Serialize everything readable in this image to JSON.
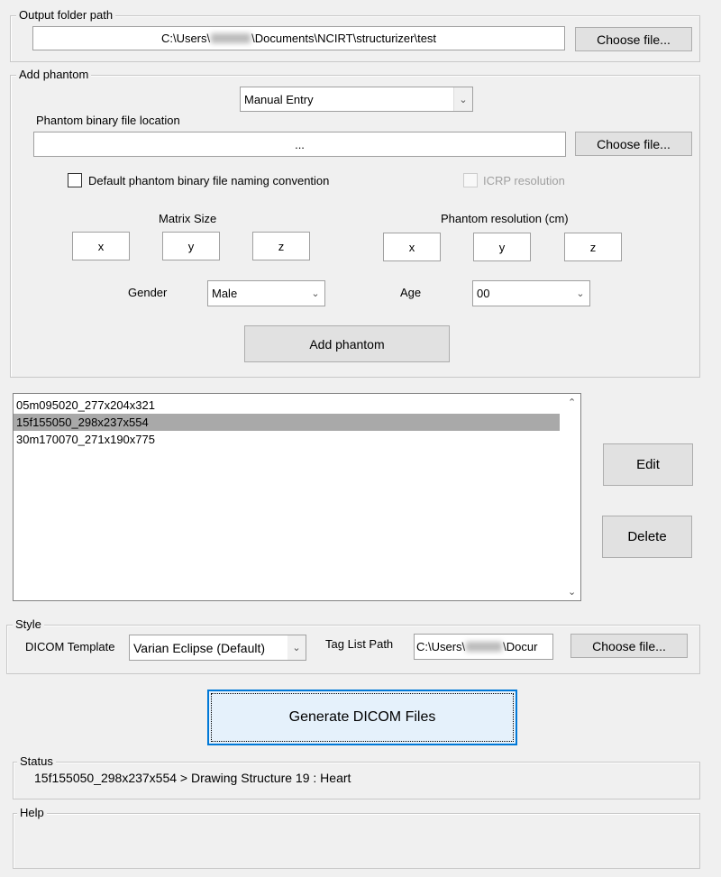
{
  "output_folder": {
    "label": "Output folder path",
    "path_prefix": "C:\\Users\\",
    "path_suffix": "\\Documents\\NCIRT\\structurizer\\test",
    "choose_label": "Choose file..."
  },
  "add_phantom": {
    "label": "Add phantom",
    "mode_select": "Manual Entry",
    "binary_location_label": "Phantom binary file location",
    "binary_location_value": "...",
    "choose_label": "Choose file...",
    "default_naming_label": "Default phantom binary file naming convention",
    "default_naming_checked": false,
    "icrp_label": "ICRP resolution",
    "icrp_checked": false,
    "matrix_size_label": "Matrix Size",
    "matrix": {
      "x": "x",
      "y": "y",
      "z": "z"
    },
    "resolution_label": "Phantom resolution (cm)",
    "resolution": {
      "x": "x",
      "y": "y",
      "z": "z"
    },
    "gender_label": "Gender",
    "gender_value": "Male",
    "age_label": "Age",
    "age_value": "00",
    "add_button": "Add phantom"
  },
  "phantom_list": {
    "items": [
      "05m095020_277x204x321",
      "15f155050_298x237x554",
      "30m170070_271x190x775"
    ],
    "selected_index": 1
  },
  "edit_button": "Edit",
  "delete_button": "Delete",
  "style": {
    "label": "Style",
    "template_label": "DICOM Template",
    "template_value": "Varian Eclipse (Default)",
    "tag_list_label": "Tag List Path",
    "tag_path_prefix": "C:\\Users\\",
    "tag_path_suffix": "\\Docur",
    "choose_label": "Choose file..."
  },
  "generate_button": "Generate DICOM Files",
  "status": {
    "label": "Status",
    "text": "15f155050_298x237x554 > Drawing Structure 19 : Heart"
  },
  "help": {
    "label": "Help"
  }
}
